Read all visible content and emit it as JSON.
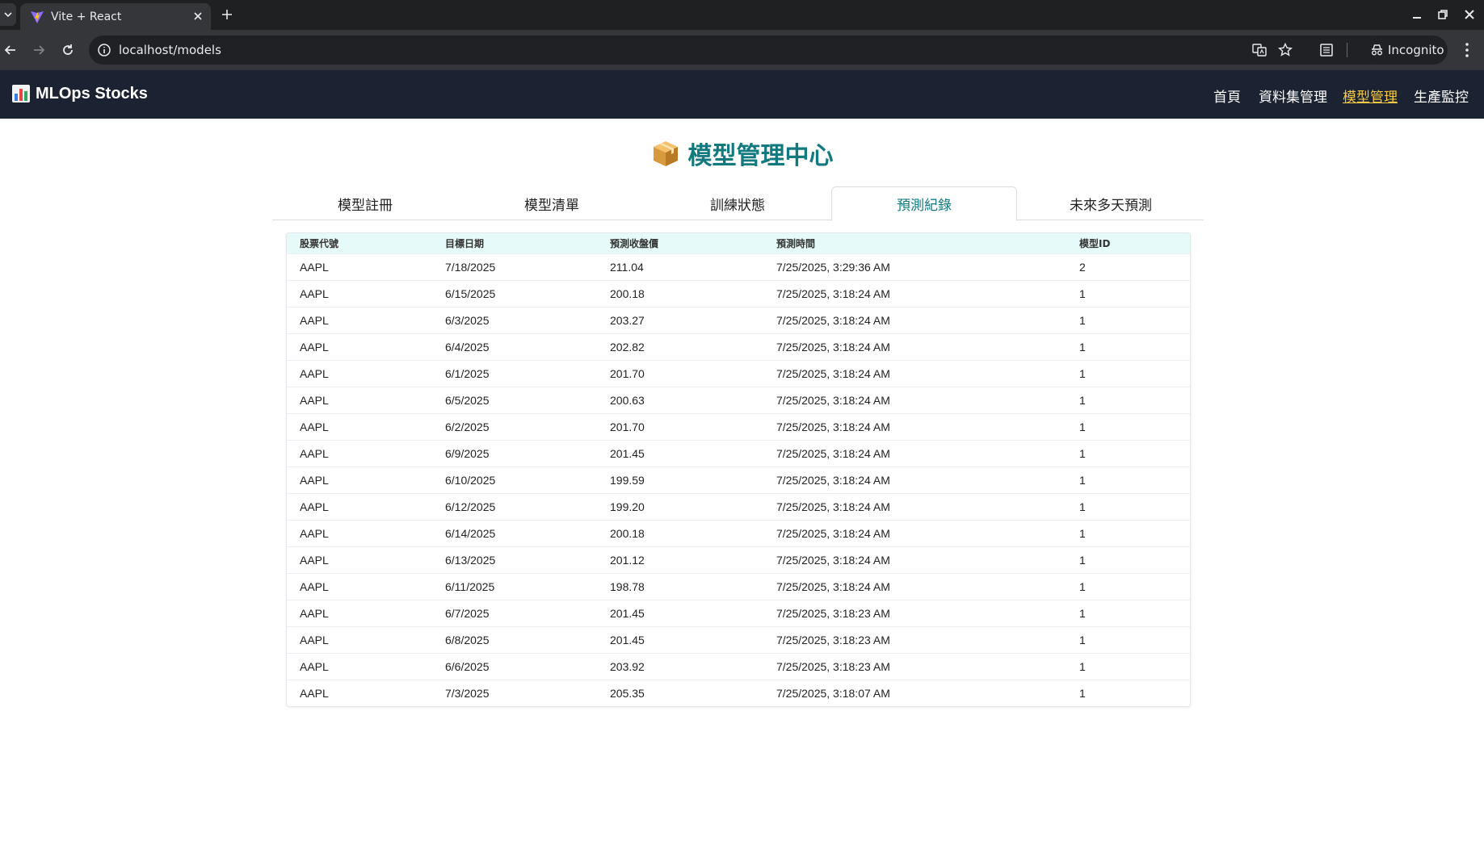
{
  "browser": {
    "tab_title": "Vite + React",
    "url": "localhost/models",
    "incognito_label": "Incognito"
  },
  "header": {
    "brand": "MLOps Stocks",
    "brand_icon": "bar-chart-icon",
    "nav": [
      {
        "label": "首頁",
        "active": false
      },
      {
        "label": "資料集管理",
        "active": false
      },
      {
        "label": "模型管理",
        "active": true
      },
      {
        "label": "生產監控",
        "active": false
      }
    ],
    "active_color": "#f6c944"
  },
  "page": {
    "title": "模型管理中心",
    "title_icon": "package-icon",
    "title_color": "#127a7f"
  },
  "tabs": [
    {
      "label": "模型註冊",
      "active": false
    },
    {
      "label": "模型清單",
      "active": false
    },
    {
      "label": "訓練狀態",
      "active": false
    },
    {
      "label": "預測紀錄",
      "active": true
    },
    {
      "label": "未來多天預測",
      "active": false
    }
  ],
  "table": {
    "columns": [
      "股票代號",
      "目標日期",
      "預測收盤價",
      "預測時間",
      "模型ID"
    ],
    "rows": [
      [
        "AAPL",
        "7/18/2025",
        "211.04",
        "7/25/2025, 3:29:36 AM",
        "2"
      ],
      [
        "AAPL",
        "6/15/2025",
        "200.18",
        "7/25/2025, 3:18:24 AM",
        "1"
      ],
      [
        "AAPL",
        "6/3/2025",
        "203.27",
        "7/25/2025, 3:18:24 AM",
        "1"
      ],
      [
        "AAPL",
        "6/4/2025",
        "202.82",
        "7/25/2025, 3:18:24 AM",
        "1"
      ],
      [
        "AAPL",
        "6/1/2025",
        "201.70",
        "7/25/2025, 3:18:24 AM",
        "1"
      ],
      [
        "AAPL",
        "6/5/2025",
        "200.63",
        "7/25/2025, 3:18:24 AM",
        "1"
      ],
      [
        "AAPL",
        "6/2/2025",
        "201.70",
        "7/25/2025, 3:18:24 AM",
        "1"
      ],
      [
        "AAPL",
        "6/9/2025",
        "201.45",
        "7/25/2025, 3:18:24 AM",
        "1"
      ],
      [
        "AAPL",
        "6/10/2025",
        "199.59",
        "7/25/2025, 3:18:24 AM",
        "1"
      ],
      [
        "AAPL",
        "6/12/2025",
        "199.20",
        "7/25/2025, 3:18:24 AM",
        "1"
      ],
      [
        "AAPL",
        "6/14/2025",
        "200.18",
        "7/25/2025, 3:18:24 AM",
        "1"
      ],
      [
        "AAPL",
        "6/13/2025",
        "201.12",
        "7/25/2025, 3:18:24 AM",
        "1"
      ],
      [
        "AAPL",
        "6/11/2025",
        "198.78",
        "7/25/2025, 3:18:24 AM",
        "1"
      ],
      [
        "AAPL",
        "6/7/2025",
        "201.45",
        "7/25/2025, 3:18:23 AM",
        "1"
      ],
      [
        "AAPL",
        "6/8/2025",
        "201.45",
        "7/25/2025, 3:18:23 AM",
        "1"
      ],
      [
        "AAPL",
        "6/6/2025",
        "203.92",
        "7/25/2025, 3:18:23 AM",
        "1"
      ],
      [
        "AAPL",
        "7/3/2025",
        "205.35",
        "7/25/2025, 3:18:07 AM",
        "1"
      ]
    ]
  }
}
